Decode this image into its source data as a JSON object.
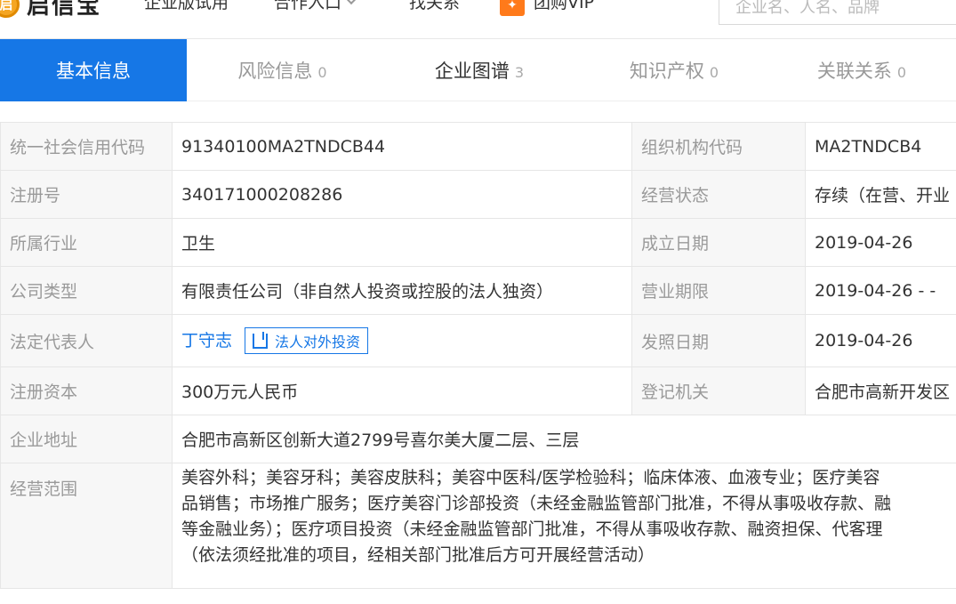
{
  "header": {
    "logo_mark": "启",
    "logo_text": "启信宝",
    "nav": [
      {
        "label": "企业版试用"
      },
      {
        "label": "合作入口"
      },
      {
        "label": "找关系"
      },
      {
        "label": "团购VIP"
      }
    ],
    "search_placeholder": "企业名、人名、品牌"
  },
  "tabs": [
    {
      "label": "基本信息",
      "count": ""
    },
    {
      "label": "风险信息",
      "count": "0"
    },
    {
      "label": "企业图谱",
      "count": "3"
    },
    {
      "label": "知识产权",
      "count": "0"
    },
    {
      "label": "关联关系",
      "count": "0"
    }
  ],
  "info": {
    "credit_code_label": "统一社会信用代码",
    "credit_code": "91340100MA2TNDCB44",
    "org_code_label": "组织机构代码",
    "org_code": "MA2TNDCB4",
    "reg_no_label": "注册号",
    "reg_no": "340171000208286",
    "status_label": "经营状态",
    "status": "存续（在营、开业",
    "industry_label": "所属行业",
    "industry": "卫生",
    "founded_label": "成立日期",
    "founded": "2019-04-26",
    "company_type_label": "公司类型",
    "company_type": "有限责任公司（非自然人投资或控股的法人独资）",
    "term_label": "营业期限",
    "term": "2019-04-26 - -",
    "legal_rep_label": "法定代表人",
    "legal_rep": "丁守志",
    "legal_invest_button": "法人对外投资",
    "issue_date_label": "发照日期",
    "issue_date": "2019-04-26",
    "capital_label": "注册资本",
    "capital": "300万元人民币",
    "authority_label": "登记机关",
    "authority": "合肥市高新开发区",
    "address_label": "企业地址",
    "address": "合肥市高新区创新大道2799号喜尔美大厦二层、三层",
    "scope_label": "经营范围",
    "scope_lines": [
      "美容外科；美容牙科；美容皮肤科；美容中医科/医学检验科；临床体液、血液专业；医疗美容",
      "品销售；市场推广服务；医疗美容门诊部投资（未经金融监管部门批准，不得从事吸收存款、融",
      "等金融业务）；医疗项目投资（未经金融监管部门批准，不得从事吸收存款、融资担保、代客理",
      "（依法须经批准的项目，经相关部门批准后方可开展经营活动）"
    ]
  },
  "colors": {
    "accent": "#1677e6",
    "vip_orange": "#ff7a1a",
    "logo_yellow": "#f5a623"
  }
}
